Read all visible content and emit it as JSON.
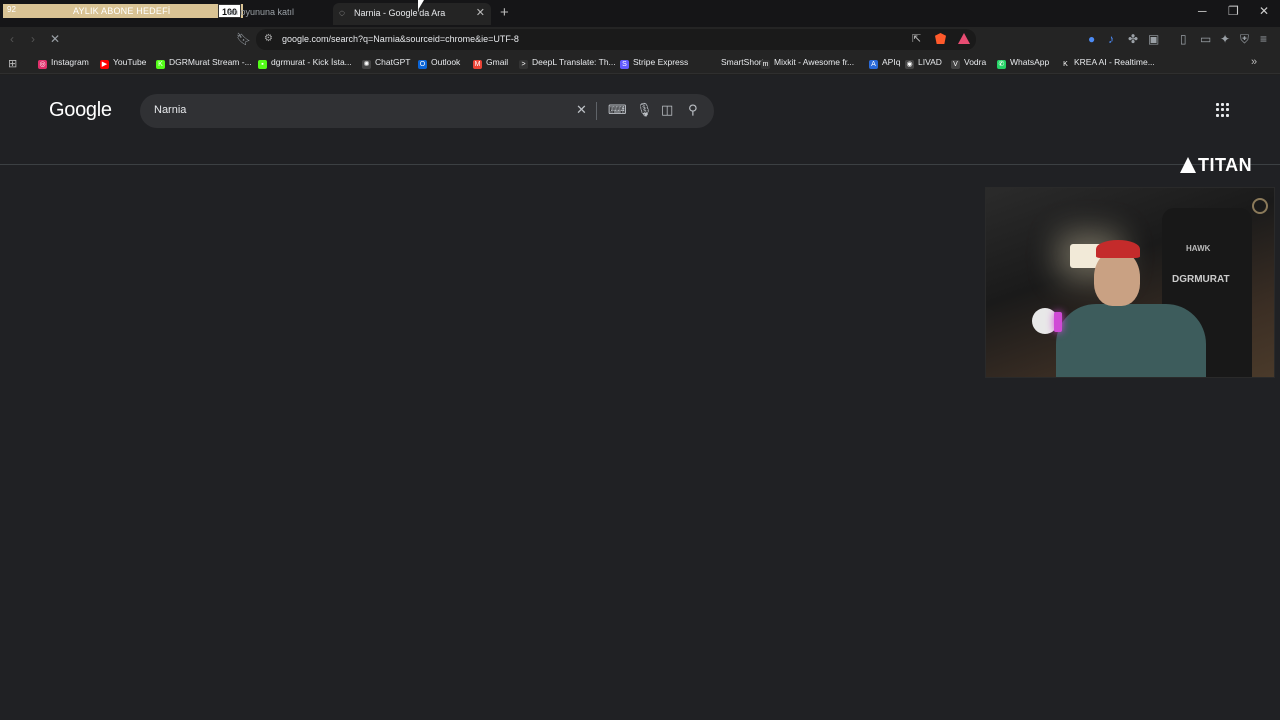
{
  "stream_overlay": {
    "goal_current": "92",
    "goal_label": "AYLIK ABONE HEDEFİ",
    "goal_target": "100",
    "brand": "TITAN",
    "chair_brand": "HAWK",
    "chair_text": "DGRMURAT"
  },
  "tabs": {
    "inactive_title": "an oyununa katıl",
    "active_title": "Narnia - Google'da Ara",
    "close_glyph": "✕",
    "new_tab_glyph": "+"
  },
  "window": {
    "minimize": "─",
    "restore": "❐",
    "close": "✕"
  },
  "toolbar": {
    "url": "google.com/search?q=Narnia&sourceid=chrome&ie=UTF-8"
  },
  "bookmarks": [
    {
      "label": "Instagram",
      "color": "#e1306c",
      "glyph": "◎"
    },
    {
      "label": "YouTube",
      "color": "#ff0000",
      "glyph": "▶"
    },
    {
      "label": "DGRMurat Stream -...",
      "color": "#53fc18",
      "glyph": "K"
    },
    {
      "label": "dgrmurat - Kick İsta...",
      "color": "#53fc18",
      "glyph": "▪"
    },
    {
      "label": "ChatGPT",
      "color": "#444",
      "glyph": "✺"
    },
    {
      "label": "Outlook",
      "color": "#0a64d6",
      "glyph": "O"
    },
    {
      "label": "Gmail",
      "color": "#ea4335",
      "glyph": "M"
    },
    {
      "label": "DeepL Translate: Th...",
      "color": "#333",
      "glyph": ">"
    },
    {
      "label": "Stripe Express",
      "color": "#635bff",
      "glyph": "S"
    },
    {
      "label": "SmartShort",
      "color": "#242424",
      "glyph": ""
    },
    {
      "label": "Mixkit - Awesome fr...",
      "color": "#333",
      "glyph": "m"
    },
    {
      "label": "APIq",
      "color": "#2a6ad8",
      "glyph": "A"
    },
    {
      "label": "LIVAD",
      "color": "#444",
      "glyph": "◉"
    },
    {
      "label": "Vodra",
      "color": "#444",
      "glyph": "V"
    },
    {
      "label": "WhatsApp",
      "color": "#25d366",
      "glyph": "✆"
    },
    {
      "label": "KREA AI - Realtime...",
      "color": "#222",
      "glyph": "K"
    }
  ],
  "google": {
    "logo": "Google",
    "query": "Narnia"
  }
}
